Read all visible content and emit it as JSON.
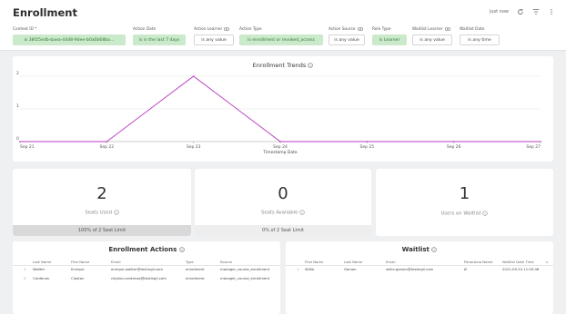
{
  "header": {
    "title": "Enrollment",
    "updated": "just now"
  },
  "filters": [
    {
      "label": "Context ID *",
      "value": "is 38f25edb-baea-4448-9dee-b0a0b68ba...",
      "active": true,
      "labelIcon": ""
    },
    {
      "label": "Action Date",
      "value": "is in the last 7 days",
      "active": true,
      "labelIcon": ""
    },
    {
      "label": "Action Learner",
      "value": "is any value",
      "active": false,
      "labelIcon": "link-icon"
    },
    {
      "label": "Action Type",
      "value": "is enrollment or revoked_access",
      "active": true,
      "labelIcon": ""
    },
    {
      "label": "Action Source",
      "value": "is any value",
      "active": false,
      "labelIcon": "link-icon"
    },
    {
      "label": "Role Type",
      "value": "is Learner",
      "active": true,
      "labelIcon": ""
    },
    {
      "label": "Waitlist Learner",
      "value": "is any value",
      "active": false,
      "labelIcon": "link-icon"
    },
    {
      "label": "Waitlist Date",
      "value": "is any time",
      "active": false,
      "labelIcon": ""
    }
  ],
  "trend": {
    "title": "Enrollment Trends",
    "xlabel": "Timestamp Date"
  },
  "chart_data": {
    "type": "line",
    "title": "Enrollment Trends",
    "xlabel": "Timestamp Date",
    "ylabel": "",
    "x": [
      "Sep 21",
      "Sep 22",
      "Sep 23",
      "Sep 24",
      "Sep 25",
      "Sep 26",
      "Sep 27"
    ],
    "y_ticks": [
      0,
      1,
      2
    ],
    "ylim": [
      0,
      2
    ],
    "series": [
      {
        "values": [
          0,
          0,
          2,
          0,
          0,
          0,
          0
        ],
        "color": "#b83ac2"
      }
    ],
    "grid": true
  },
  "stats": [
    {
      "value": "2",
      "label": "Seats Used",
      "footer": "100% of 2 Seat Limit",
      "footerStyle": "gray"
    },
    {
      "value": "0",
      "label": "Seats Available",
      "footer": "0% of 2 Seat Limit",
      "footerStyle": "light"
    },
    {
      "value": "1",
      "label": "Users on Waitlist",
      "footer": "",
      "footerStyle": "none"
    }
  ],
  "enrollment_actions": {
    "title": "Enrollment Actions",
    "columns": [
      "Last Name",
      "First Name",
      "Email",
      "Type",
      "Source"
    ],
    "rows": [
      {
        "num": "1",
        "cells": [
          "Waliter",
          "Enrique",
          "enrique.waliter@testingli.com",
          "enrollment",
          "manager_course_enrollment"
        ]
      },
      {
        "num": "2",
        "cells": [
          "Cardenas",
          "Clayton",
          "clayton.cardenas@testingli.com",
          "enrollment",
          "manager_course_enrollment"
        ]
      }
    ]
  },
  "waitlist": {
    "title": "Waitlist",
    "columns": [
      "First Name",
      "Last Name",
      "Email",
      "Panorama Name",
      "Waitlist Date Time"
    ],
    "rows": [
      {
        "num": "1",
        "cells": [
          "Willie",
          "Garson",
          "willie.garson@testingli.com",
          "Ø",
          "2021-09-24 11:55:46"
        ]
      }
    ]
  }
}
